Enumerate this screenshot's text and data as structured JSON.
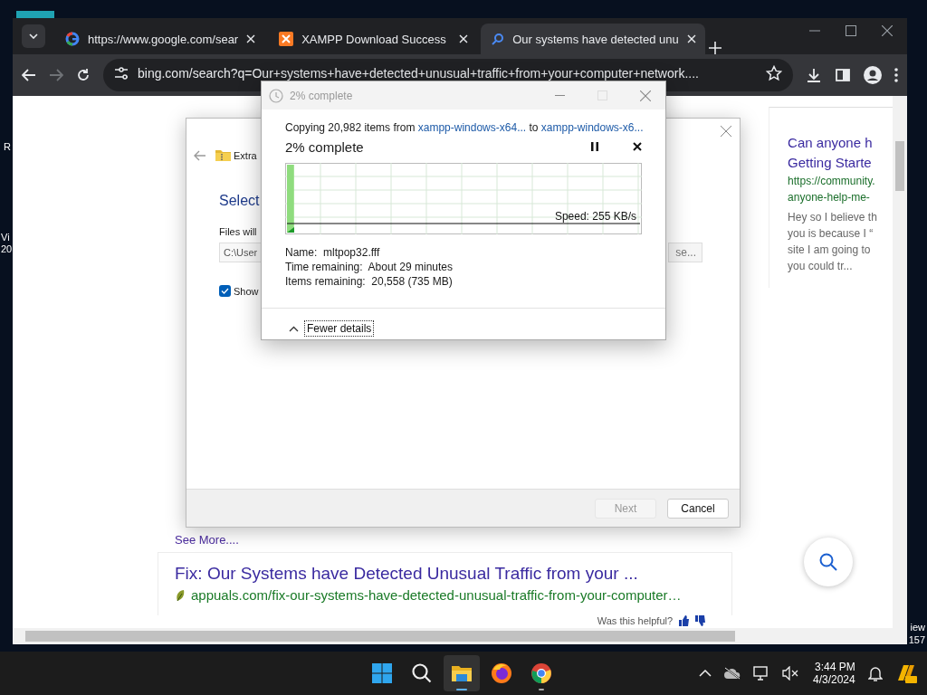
{
  "desktop": {
    "left_labels": [
      "R",
      "Vi",
      "20"
    ],
    "right_labels": [
      "iew",
      "157"
    ]
  },
  "browser": {
    "tabs": [
      {
        "title": "https://www.google.com/sear",
        "kind": "google",
        "selected": false
      },
      {
        "title": "XAMPP Download Success",
        "kind": "xampp",
        "selected": false
      },
      {
        "title": "Our systems have detected unu",
        "kind": "search",
        "selected": true
      }
    ],
    "address": "bing.com/search?q=Our+systems+have+detected+unusual+traffic+from+your+computer+network....",
    "results": {
      "see_more": "See More....",
      "result_title": "Fix: Our Systems have Detected Unusual Traffic from your ...",
      "result_url": "appuals.com/fix-our-systems-have-detected-unusual-traffic-from-your-computer…",
      "feedback": "Was this helpful?"
    },
    "side_card": {
      "title_lines": [
        "Can anyone h",
        "Getting Starte"
      ],
      "url_lines": [
        "https://community.",
        "anyone-help-me-"
      ],
      "snippet_lines": [
        "Hey so I believe th",
        "you is because I “",
        "site I am going to",
        "you could tr..."
      ]
    }
  },
  "extract_dialog": {
    "header": "Extra",
    "heading": "Select",
    "field_label": "Files will",
    "path": "C:\\User",
    "browse": "se...",
    "checkbox": {
      "label": "Show",
      "checked": true
    },
    "buttons": [
      {
        "label": "Next",
        "disabled": true
      },
      {
        "label": "Cancel",
        "disabled": false
      }
    ]
  },
  "copy_dialog": {
    "title": "2% complete",
    "copying": {
      "prefix": "Copying 20,982 items from",
      "source": "xampp-windows-x64...",
      "middle": "to",
      "destination": "xampp-windows-x6..."
    },
    "heading": "2% complete",
    "progress": {
      "level": 0.02,
      "speed": "Speed: 255 KB/s"
    },
    "details": [
      "Name:  mltpop32.fff",
      "Time remaining:  About 29 minutes",
      "Items remaining:  20,558 (735 MB)"
    ],
    "toggle": "Fewer details"
  },
  "taskbar": {
    "apps": [
      {
        "kind": "start",
        "selected": false,
        "open": false
      },
      {
        "kind": "search",
        "selected": false,
        "open": false
      },
      {
        "kind": "explorer",
        "selected": true,
        "open": true
      },
      {
        "kind": "firefox",
        "selected": false,
        "open": false
      },
      {
        "kind": "chrome",
        "selected": false,
        "open": true
      }
    ],
    "time": "3:44 PM",
    "date": "4/3/2024"
  }
}
